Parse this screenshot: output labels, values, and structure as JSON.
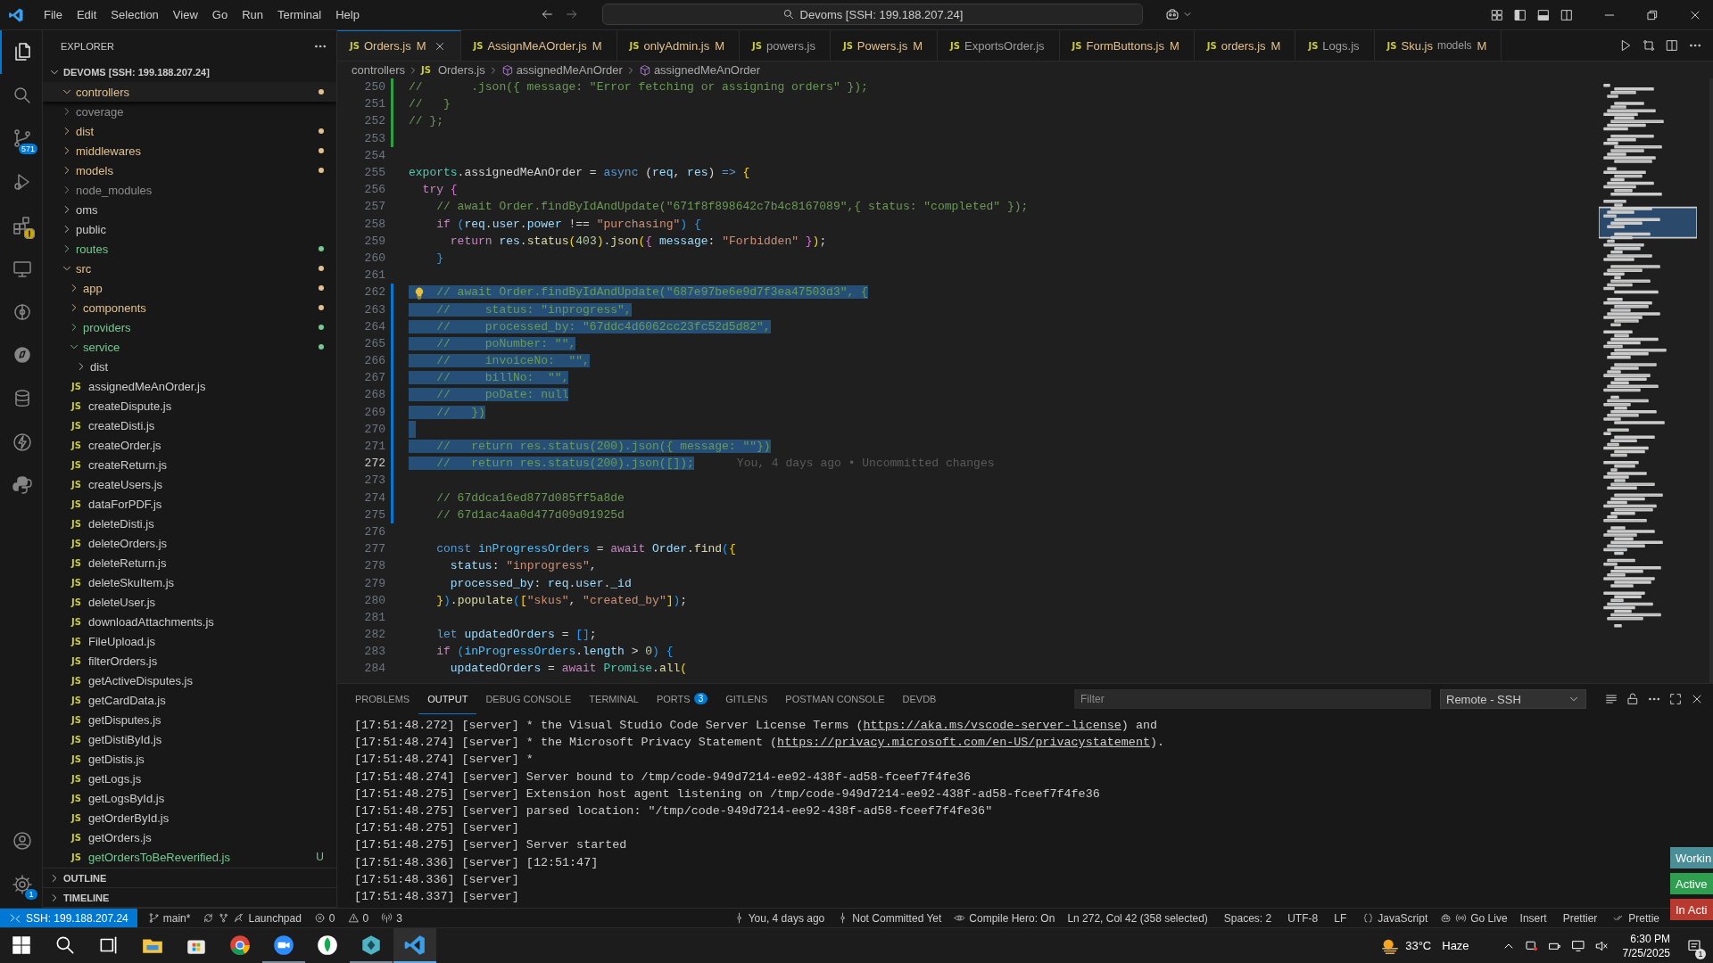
{
  "title_bar": {
    "menu": [
      "File",
      "Edit",
      "Selection",
      "View",
      "Go",
      "Run",
      "Terminal",
      "Help"
    ],
    "command_center": "Devoms [SSH: 199.188.207.24]"
  },
  "activity_bar": {
    "items": [
      {
        "kind": "files",
        "selected": true
      },
      {
        "kind": "search",
        "selected": false
      },
      {
        "kind": "branch",
        "selected": false,
        "badge": "571"
      },
      {
        "kind": "run",
        "selected": false
      },
      {
        "kind": "extensions",
        "selected": false,
        "warning": true
      },
      {
        "kind": "monitor",
        "selected": false
      },
      {
        "kind": "timeline",
        "selected": false
      },
      {
        "kind": "compass",
        "selected": false
      },
      {
        "kind": "database",
        "selected": false
      },
      {
        "kind": "bolt",
        "selected": false
      },
      {
        "kind": "python",
        "selected": false
      }
    ],
    "bottom": [
      {
        "kind": "accounts"
      },
      {
        "kind": "settings",
        "badge": "1"
      }
    ]
  },
  "sidebar": {
    "title": "EXPLORER",
    "root": {
      "label": "DEVOMS [SSH: 199.188.207.24]",
      "expanded": true
    },
    "tree": [
      {
        "label": "controllers",
        "kind": "folder",
        "expanded": true,
        "color": "#e2c08d",
        "dot": true
      },
      {
        "label": "coverage",
        "kind": "folder",
        "expanded": false,
        "color": "#8c8c8c",
        "dot": false
      },
      {
        "label": "dist",
        "kind": "folder",
        "expanded": false,
        "color": "#e2c08d",
        "dot": true
      },
      {
        "label": "middlewares",
        "kind": "folder",
        "expanded": false,
        "color": "#e2c08d",
        "dot": true
      },
      {
        "label": "models",
        "kind": "folder",
        "expanded": false,
        "color": "#e2c08d",
        "dot": true
      },
      {
        "label": "node_modules",
        "kind": "folder",
        "expanded": false,
        "color": "#8c8c8c",
        "dot": false
      },
      {
        "label": "oms",
        "kind": "folder",
        "expanded": false,
        "color": "#cccccc",
        "dot": false
      },
      {
        "label": "public",
        "kind": "folder",
        "expanded": false,
        "color": "#cccccc",
        "dot": false
      },
      {
        "label": "routes",
        "kind": "folder",
        "expanded": false,
        "color": "#73c991",
        "dot": true
      },
      {
        "label": "src",
        "kind": "folder",
        "expanded": true,
        "color": "#e2c08d",
        "dot": true,
        "children": [
          {
            "label": "app",
            "kind": "folder",
            "expanded": false,
            "color": "#e2c08d",
            "dot": true
          },
          {
            "label": "components",
            "kind": "folder",
            "expanded": false,
            "color": "#e2c08d",
            "dot": true
          },
          {
            "label": "providers",
            "kind": "folder",
            "expanded": false,
            "color": "#73c991",
            "dot": true
          },
          {
            "label": "service",
            "kind": "folder",
            "expanded": true,
            "color": "#73c991",
            "dot": true,
            "children": [
              {
                "label": "dist",
                "kind": "folder",
                "expanded": false,
                "color": "#cccccc",
                "dot": false
              },
              {
                "label": "assignedMeAnOrder.js",
                "kind": "file",
                "icon": "JS",
                "color": "#cccccc"
              },
              {
                "label": "createDispute.js",
                "kind": "file",
                "icon": "JS",
                "color": "#cccccc"
              },
              {
                "label": "createDisti.js",
                "kind": "file",
                "icon": "JS",
                "color": "#cccccc"
              },
              {
                "label": "createOrder.js",
                "kind": "file",
                "icon": "JS",
                "color": "#cccccc"
              },
              {
                "label": "createReturn.js",
                "kind": "file",
                "icon": "JS",
                "color": "#cccccc"
              },
              {
                "label": "createUsers.js",
                "kind": "file",
                "icon": "JS",
                "color": "#cccccc"
              },
              {
                "label": "dataForPDF.js",
                "kind": "file",
                "icon": "JS",
                "color": "#cccccc"
              },
              {
                "label": "deleteDisti.js",
                "kind": "file",
                "icon": "JS",
                "color": "#cccccc"
              },
              {
                "label": "deleteOrders.js",
                "kind": "file",
                "icon": "JS",
                "color": "#cccccc"
              },
              {
                "label": "deleteReturn.js",
                "kind": "file",
                "icon": "JS",
                "color": "#cccccc"
              },
              {
                "label": "deleteSkuItem.js",
                "kind": "file",
                "icon": "JS",
                "color": "#cccccc"
              },
              {
                "label": "deleteUser.js",
                "kind": "file",
                "icon": "JS",
                "color": "#cccccc"
              },
              {
                "label": "downloadAttachments.js",
                "kind": "file",
                "icon": "JS",
                "color": "#cccccc"
              },
              {
                "label": "FileUpload.js",
                "kind": "file",
                "icon": "JS",
                "color": "#cccccc"
              },
              {
                "label": "filterOrders.js",
                "kind": "file",
                "icon": "JS",
                "color": "#cccccc"
              },
              {
                "label": "getActiveDisputes.js",
                "kind": "file",
                "icon": "JS",
                "color": "#cccccc"
              },
              {
                "label": "getCardData.js",
                "kind": "file",
                "icon": "JS",
                "color": "#cccccc"
              },
              {
                "label": "getDisputes.js",
                "kind": "file",
                "icon": "JS",
                "color": "#cccccc"
              },
              {
                "label": "getDistiById.js",
                "kind": "file",
                "icon": "JS",
                "color": "#cccccc"
              },
              {
                "label": "getDistis.js",
                "kind": "file",
                "icon": "JS",
                "color": "#cccccc"
              },
              {
                "label": "getLogs.js",
                "kind": "file",
                "icon": "JS",
                "color": "#cccccc"
              },
              {
                "label": "getLogsById.js",
                "kind": "file",
                "icon": "JS",
                "color": "#cccccc"
              },
              {
                "label": "getOrderById.js",
                "kind": "file",
                "icon": "JS",
                "color": "#cccccc"
              },
              {
                "label": "getOrders.js",
                "kind": "file",
                "icon": "JS",
                "color": "#cccccc"
              },
              {
                "label": "getOrdersToBeReverified.js",
                "kind": "file",
                "icon": "JS",
                "color": "#73c991",
                "badge": "U"
              }
            ]
          }
        ]
      }
    ],
    "sections": [
      {
        "label": "OUTLINE",
        "expanded": false
      },
      {
        "label": "TIMELINE",
        "expanded": false
      }
    ]
  },
  "tabs": [
    {
      "icon": "JS",
      "label": "Orders.js",
      "badge": "M",
      "modified": true,
      "selected": true
    },
    {
      "icon": "JS",
      "label": "AssignMeAOrder.js",
      "badge": "M",
      "modified": true,
      "selected": false
    },
    {
      "icon": "JS",
      "label": "onlyAdmin.js",
      "badge": "M",
      "modified": true,
      "selected": false
    },
    {
      "icon": "JS",
      "label": "powers.js",
      "modified": false,
      "selected": false
    },
    {
      "icon": "JS",
      "label": "Powers.js",
      "badge": "M",
      "modified": true,
      "selected": false
    },
    {
      "icon": "JS",
      "label": "ExportsOrder.js",
      "modified": false,
      "selected": false
    },
    {
      "icon": "JS",
      "label": "FormButtons.js",
      "badge": "M",
      "modified": true,
      "selected": false
    },
    {
      "icon": "JS",
      "label": "orders.js",
      "badge": "M",
      "modified": true,
      "selected": false
    },
    {
      "icon": "JS",
      "label": "Logs.js",
      "modified": false,
      "selected": false
    },
    {
      "icon": "JS",
      "label": "Sku.js",
      "description": "models",
      "badge": "M",
      "modified": true,
      "selected": false
    }
  ],
  "breadcrumb": [
    {
      "kind": "folder",
      "text": "controllers"
    },
    {
      "kind": "file",
      "icon": "JS",
      "text": "Orders.js"
    },
    {
      "kind": "symbol",
      "text": "assignedMeAnOrder"
    },
    {
      "kind": "symbol",
      "text": "assignedMeAnOrder"
    }
  ],
  "editor": {
    "lines": [
      {
        "num": "250",
        "color": "#2ea043",
        "tokens": [
          {
            "text": "//       .json({ message: \"Error fetching or assigning orders\" });",
            "kind": "c"
          }
        ]
      },
      {
        "num": "251",
        "color": "#2ea043",
        "tokens": [
          {
            "text": "//   }",
            "kind": "c"
          }
        ]
      },
      {
        "num": "252",
        "color": "#2ea043",
        "tokens": [
          {
            "text": "// };",
            "kind": "c"
          }
        ]
      },
      {
        "num": "253",
        "color": "#2ea043"
      },
      {
        "num": "254"
      },
      {
        "num": "255",
        "tokens": [
          {
            "text": "exports",
            "kind": "t"
          },
          {
            "text": ".assignedMeAnOrder = ",
            "kind": "w"
          },
          {
            "text": "async",
            "kind": "k"
          },
          {
            "text": " (",
            "kind": "w"
          },
          {
            "text": "req",
            "kind": "v"
          },
          {
            "text": ", ",
            "kind": "w"
          },
          {
            "text": "res",
            "kind": "v"
          },
          {
            "text": ") ",
            "kind": "w"
          },
          {
            "text": "=>",
            "kind": "k"
          },
          {
            "text": " {",
            "kind": "b1"
          }
        ]
      },
      {
        "num": "256",
        "tokens": [
          {
            "text": "  try",
            "kind": "p"
          },
          {
            "text": " {",
            "kind": "b2"
          }
        ]
      },
      {
        "num": "257",
        "tokens": [
          {
            "text": "    // await Order.findByIdAndUpdate(\"671f8f898642c7b4c8167089\",{ status: \"completed\" });",
            "kind": "c"
          }
        ]
      },
      {
        "num": "258",
        "tokens": [
          {
            "text": "    if",
            "kind": "p"
          },
          {
            "text": " (",
            "kind": "b3"
          },
          {
            "text": "req",
            "kind": "v"
          },
          {
            "text": ".",
            "kind": "w"
          },
          {
            "text": "user",
            "kind": "v"
          },
          {
            "text": ".",
            "kind": "w"
          },
          {
            "text": "power",
            "kind": "v"
          },
          {
            "text": " !== ",
            "kind": "w"
          },
          {
            "text": "\"purchasing\"",
            "kind": "s"
          },
          {
            "text": ")",
            "kind": "b3"
          },
          {
            "text": " {",
            "kind": "b3"
          }
        ]
      },
      {
        "num": "259",
        "tokens": [
          {
            "text": "      return",
            "kind": "p"
          },
          {
            "text": " res",
            "kind": "v"
          },
          {
            "text": ".",
            "kind": "w"
          },
          {
            "text": "status",
            "kind": "f"
          },
          {
            "text": "(",
            "kind": "b1"
          },
          {
            "text": "403",
            "kind": "n"
          },
          {
            "text": ")",
            "kind": "b1"
          },
          {
            "text": ".",
            "kind": "w"
          },
          {
            "text": "json",
            "kind": "f"
          },
          {
            "text": "(",
            "kind": "b1"
          },
          {
            "text": "{ ",
            "kind": "b2"
          },
          {
            "text": "message",
            "kind": "v"
          },
          {
            "text": ": ",
            "kind": "w"
          },
          {
            "text": "\"Forbidden\"",
            "kind": "s"
          },
          {
            "text": " }",
            "kind": "b2"
          },
          {
            "text": ")",
            "kind": "b1"
          },
          {
            "text": ";",
            "kind": "w"
          }
        ]
      },
      {
        "num": "260",
        "tokens": [
          {
            "text": "    }",
            "kind": "b3"
          }
        ]
      },
      {
        "num": "261"
      },
      {
        "num": "262",
        "color": "#0078d4",
        "hint": true,
        "selected": true,
        "tokens": [
          {
            "text": "    // await Order.findByIdAndUpdate(\"687e97be6e9d7f3ea47503d3\", {",
            "kind": "c"
          }
        ]
      },
      {
        "num": "263",
        "color": "#0078d4",
        "selected": true,
        "tokens": [
          {
            "text": "    //     status: \"inprogress\",",
            "kind": "c"
          }
        ]
      },
      {
        "num": "264",
        "color": "#0078d4",
        "selected": true,
        "tokens": [
          {
            "text": "    //     processed_by: \"67ddc4d6062cc23fc52d5d82\",",
            "kind": "c"
          }
        ]
      },
      {
        "num": "265",
        "color": "#0078d4",
        "selected": true,
        "tokens": [
          {
            "text": "    //     poNumber: \"\",",
            "kind": "c"
          }
        ]
      },
      {
        "num": "266",
        "color": "#0078d4",
        "selected": true,
        "tokens": [
          {
            "text": "    //     invoiceNo:  \"\",",
            "kind": "c"
          }
        ]
      },
      {
        "num": "267",
        "color": "#0078d4",
        "selected": true,
        "tokens": [
          {
            "text": "    //     billNo:  \"\",",
            "kind": "c"
          }
        ]
      },
      {
        "num": "268",
        "color": "#0078d4",
        "selected": true,
        "tokens": [
          {
            "text": "    //     poDate: null",
            "kind": "c"
          }
        ]
      },
      {
        "num": "269",
        "color": "#0078d4",
        "selected": true,
        "tokens": [
          {
            "text": "    //   })",
            "kind": "c"
          }
        ]
      },
      {
        "num": "270",
        "color": "#0078d4",
        "selected": true
      },
      {
        "num": "271",
        "color": "#0078d4",
        "selected": true,
        "tokens": [
          {
            "text": "    //   return res.status(200).json({ message: \"\"})",
            "kind": "c"
          }
        ]
      },
      {
        "num": "272",
        "color": "#0078d4",
        "selected": true,
        "current": true,
        "blame": "You, 4 days ago • Uncommitted changes",
        "tokens": [
          {
            "text": "    //   return res.status(200).json([]);",
            "kind": "c"
          }
        ]
      },
      {
        "num": "273",
        "color": "#0078d4"
      },
      {
        "num": "274",
        "color": "#0078d4",
        "tokens": [
          {
            "text": "    // 67ddca16ed877d085ff5a8de",
            "kind": "c"
          }
        ]
      },
      {
        "num": "275",
        "color": "#0078d4",
        "tokens": [
          {
            "text": "    // 67d1ac4aa0d477d09d91925d",
            "kind": "c"
          }
        ]
      },
      {
        "num": "276"
      },
      {
        "num": "277",
        "tokens": [
          {
            "text": "    const",
            "kind": "k"
          },
          {
            "text": " inProgressOrders",
            "kind": "cn"
          },
          {
            "text": " = ",
            "kind": "w"
          },
          {
            "text": "await",
            "kind": "p"
          },
          {
            "text": " Order",
            "kind": "v"
          },
          {
            "text": ".",
            "kind": "w"
          },
          {
            "text": "find",
            "kind": "f"
          },
          {
            "text": "(",
            "kind": "b3"
          },
          {
            "text": "{",
            "kind": "b1"
          }
        ]
      },
      {
        "num": "278",
        "tokens": [
          {
            "text": "      status",
            "kind": "v"
          },
          {
            "text": ": ",
            "kind": "w"
          },
          {
            "text": "\"inprogress\"",
            "kind": "s"
          },
          {
            "text": ",",
            "kind": "w"
          }
        ]
      },
      {
        "num": "279",
        "tokens": [
          {
            "text": "      processed_by",
            "kind": "v"
          },
          {
            "text": ": ",
            "kind": "w"
          },
          {
            "text": "req",
            "kind": "v"
          },
          {
            "text": ".",
            "kind": "w"
          },
          {
            "text": "user",
            "kind": "v"
          },
          {
            "text": ".",
            "kind": "w"
          },
          {
            "text": "_id",
            "kind": "v"
          }
        ]
      },
      {
        "num": "280",
        "tokens": [
          {
            "text": "    }",
            "kind": "b1"
          },
          {
            "text": ")",
            "kind": "b3"
          },
          {
            "text": ".",
            "kind": "w"
          },
          {
            "text": "populate",
            "kind": "f"
          },
          {
            "text": "(",
            "kind": "b3"
          },
          {
            "text": "[",
            "kind": "b1"
          },
          {
            "text": "\"skus\"",
            "kind": "s"
          },
          {
            "text": ", ",
            "kind": "w"
          },
          {
            "text": "\"created_by\"",
            "kind": "s"
          },
          {
            "text": "]",
            "kind": "b1"
          },
          {
            "text": ")",
            "kind": "b3"
          },
          {
            "text": ";",
            "kind": "w"
          }
        ]
      },
      {
        "num": "281"
      },
      {
        "num": "282",
        "tokens": [
          {
            "text": "    let",
            "kind": "k"
          },
          {
            "text": " updatedOrders",
            "kind": "v"
          },
          {
            "text": " = ",
            "kind": "w"
          },
          {
            "text": "[]",
            "kind": "b3"
          },
          {
            "text": ";",
            "kind": "w"
          }
        ]
      },
      {
        "num": "283",
        "tokens": [
          {
            "text": "    if",
            "kind": "p"
          },
          {
            "text": " (",
            "kind": "b3"
          },
          {
            "text": "inProgressOrders",
            "kind": "cn"
          },
          {
            "text": ".",
            "kind": "w"
          },
          {
            "text": "length",
            "kind": "v"
          },
          {
            "text": " > ",
            "kind": "w"
          },
          {
            "text": "0",
            "kind": "n"
          },
          {
            "text": ")",
            "kind": "b3"
          },
          {
            "text": " {",
            "kind": "b3"
          }
        ]
      },
      {
        "num": "284",
        "tokens": [
          {
            "text": "      updatedOrders",
            "kind": "v"
          },
          {
            "text": " = ",
            "kind": "w"
          },
          {
            "text": "await",
            "kind": "p"
          },
          {
            "text": " Promise",
            "kind": "t"
          },
          {
            "text": ".",
            "kind": "w"
          },
          {
            "text": "all",
            "kind": "f"
          },
          {
            "text": "(",
            "kind": "b1"
          }
        ]
      }
    ]
  },
  "panel": {
    "tabs": [
      {
        "label": "PROBLEMS",
        "selected": false
      },
      {
        "label": "OUTPUT",
        "selected": true
      },
      {
        "label": "DEBUG CONSOLE",
        "selected": false
      },
      {
        "label": "TERMINAL",
        "selected": false
      },
      {
        "label": "PORTS",
        "selected": false,
        "badge": "3"
      },
      {
        "label": "GITLENS",
        "selected": false
      },
      {
        "label": "POSTMAN CONSOLE",
        "selected": false
      },
      {
        "label": "DEVDB",
        "selected": false
      }
    ],
    "filter": {
      "placeholder": "Filter"
    },
    "channel": "Remote - SSH",
    "lines": [
      {
        "parts": [
          {
            "kind": "text",
            "text": "[17:51:48.272] [server] * the Visual Studio Code Server License Terms ("
          },
          {
            "kind": "link",
            "text": "https://aka.ms/vscode-server-license"
          },
          {
            "kind": "text",
            "text": ") and"
          }
        ]
      },
      {
        "parts": [
          {
            "kind": "text",
            "text": "[17:51:48.274] [server] * the Microsoft Privacy Statement ("
          },
          {
            "kind": "link",
            "text": "https://privacy.microsoft.com/en-US/privacystatement"
          },
          {
            "kind": "text",
            "text": ")."
          }
        ]
      },
      {
        "parts": [
          {
            "kind": "text",
            "text": "[17:51:48.274] [server] *"
          }
        ]
      },
      {
        "parts": [
          {
            "kind": "text",
            "text": "[17:51:48.274] [server] Server bound to /tmp/code-949d7214-ee92-438f-ad58-fceef7f4fe36"
          }
        ]
      },
      {
        "parts": [
          {
            "kind": "text",
            "text": "[17:51:48.275] [server] Extension host agent listening on /tmp/code-949d7214-ee92-438f-ad58-fceef7f4fe36"
          }
        ]
      },
      {
        "parts": [
          {
            "kind": "text",
            "text": "[17:51:48.275] [server] parsed location: \"/tmp/code-949d7214-ee92-438f-ad58-fceef7f4fe36\""
          }
        ]
      },
      {
        "parts": [
          {
            "kind": "text",
            "text": "[17:51:48.275] [server]"
          }
        ]
      },
      {
        "parts": [
          {
            "kind": "text",
            "text": "[17:51:48.275] [server] Server started"
          }
        ]
      },
      {
        "parts": [
          {
            "kind": "text",
            "text": "[17:51:48.336] [server] [12:51:47]"
          }
        ]
      },
      {
        "parts": [
          {
            "kind": "text",
            "text": "[17:51:48.336] [server]"
          }
        ]
      },
      {
        "parts": [
          {
            "kind": "text",
            "text": "[17:51:48.337] [server]"
          }
        ]
      }
    ]
  },
  "side_notices": [
    {
      "label": "Workin",
      "color": "#4a8e98"
    },
    {
      "label": "Active",
      "color": "#2e9f4e"
    },
    {
      "label": "In Acti",
      "color": "#b8392f"
    }
  ],
  "status_bar": {
    "left": [
      {
        "kind": "remote",
        "text": "SSH: 199.188.207.24"
      },
      {
        "kind": "branch",
        "text": "main*"
      },
      {
        "kind": "sync"
      },
      {
        "kind": "graph"
      },
      {
        "kind": "launchpad",
        "text": "Launchpad"
      },
      {
        "kind": "errors",
        "text": "0"
      },
      {
        "kind": "warnings",
        "text": "0"
      },
      {
        "kind": "ports",
        "text": "3"
      }
    ],
    "right": [
      {
        "kind": "commit",
        "text": "You, 4 days ago"
      },
      {
        "kind": "commit",
        "text": "Not Committed Yet"
      },
      {
        "kind": "eye",
        "text": "Compile Hero: On"
      },
      {
        "kind": "plain",
        "text": "Ln 272, Col 42 (358 selected)"
      },
      {
        "kind": "plain",
        "text": "Spaces: 2"
      },
      {
        "kind": "plain",
        "text": "UTF-8"
      },
      {
        "kind": "plain",
        "text": "LF"
      },
      {
        "kind": "braces",
        "text": "JavaScript"
      },
      {
        "kind": "copilot"
      },
      {
        "kind": "broadcast",
        "text": "Go Live"
      },
      {
        "kind": "plain",
        "text": "Insert"
      },
      {
        "kind": "plain",
        "text": "Prettier"
      },
      {
        "kind": "checks",
        "text": "Prettie"
      }
    ]
  },
  "taskbar": {
    "apps": [
      {
        "kind": "start",
        "running": false,
        "selected": false
      },
      {
        "kind": "search",
        "running": false,
        "selected": false
      },
      {
        "kind": "taskview",
        "running": false,
        "selected": false
      },
      {
        "kind": "folder",
        "running": false,
        "selected": false
      },
      {
        "kind": "store",
        "running": false,
        "selected": false
      },
      {
        "kind": "chrome",
        "running": false,
        "selected": false
      },
      {
        "kind": "zoom",
        "running": true,
        "selected": false
      },
      {
        "kind": "leaf",
        "running": false,
        "selected": false
      },
      {
        "kind": "hexagon",
        "running": true,
        "selected": false
      },
      {
        "kind": "vscode",
        "running": true,
        "selected": true
      }
    ],
    "weather": {
      "temp": "33°C",
      "condition": "Haze"
    },
    "time": "6:30 PM",
    "date": "7/25/2025",
    "notifications": "1"
  }
}
